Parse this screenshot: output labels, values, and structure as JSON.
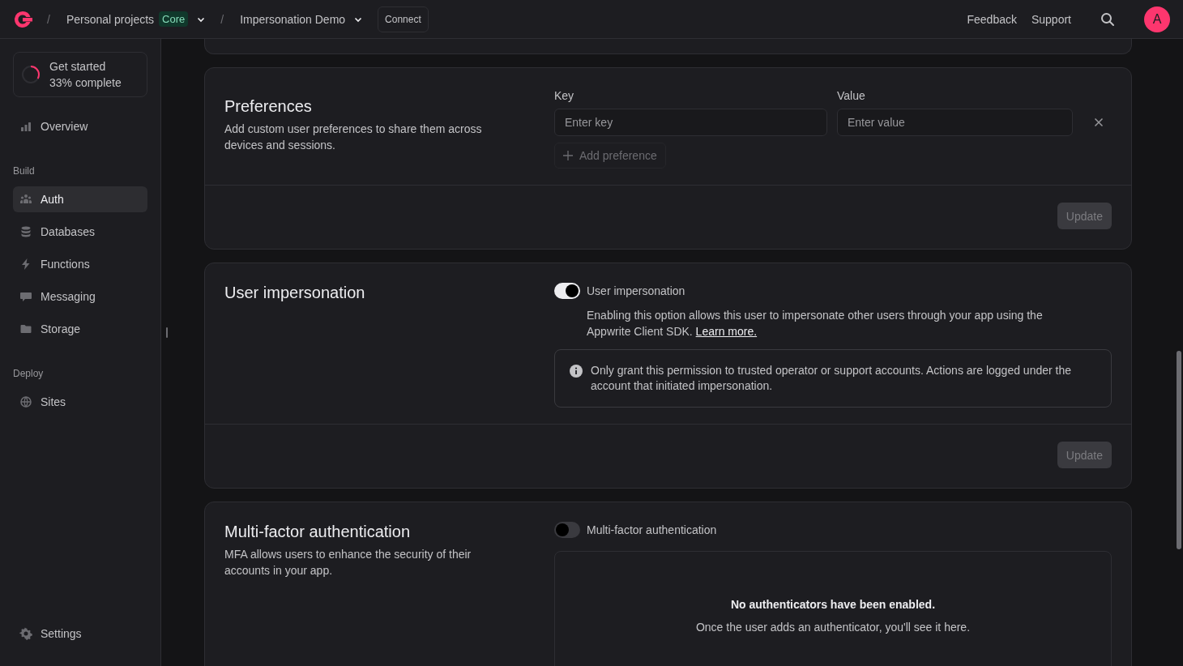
{
  "topbar": {
    "breadcrumbs": [
      {
        "separator": "/",
        "label": "Personal projects",
        "badge": "Core"
      },
      {
        "separator": "/",
        "label": "Impersonation Demo"
      }
    ],
    "connect": "Connect",
    "links": [
      "Feedback",
      "Support"
    ],
    "avatar": "A"
  },
  "sidebar": {
    "progress": {
      "title": "Get started",
      "subtitle": "33% complete",
      "level": 0.33
    },
    "groups": [
      {
        "items": [
          {
            "label": "Overview",
            "selected": false
          }
        ]
      },
      {
        "heading": "Build",
        "items": [
          {
            "label": "Auth",
            "selected": true
          },
          {
            "label": "Databases",
            "selected": false
          },
          {
            "label": "Functions",
            "selected": false
          },
          {
            "label": "Messaging",
            "selected": false
          },
          {
            "label": "Storage",
            "selected": false
          }
        ]
      },
      {
        "heading": "Deploy",
        "items": [
          {
            "label": "Sites",
            "selected": false
          }
        ]
      }
    ],
    "footer": {
      "label": "Settings",
      "selected": false
    }
  },
  "preferences": {
    "title": "Preferences",
    "description": "Add custom user preferences to share them across devices and sessions.",
    "key_label": "Key",
    "value_label": "Value",
    "key_placeholder": "Enter key",
    "value_placeholder": "Enter value",
    "add_button": "Add preference",
    "update_button": {
      "label": "Update",
      "disabled": true
    }
  },
  "impersonation": {
    "title": "User impersonation",
    "toggle": {
      "label": "User impersonation",
      "on": true
    },
    "description": "Enabling this option allows this user to impersonate other users through your app using the Appwrite Client SDK.",
    "link": "Learn more.",
    "notice": "Only grant this permission to trusted operator or support accounts. Actions are logged under the account that initiated impersonation.",
    "update_button": {
      "label": "Update",
      "disabled": true
    }
  },
  "mfa": {
    "title": "Multi-factor authentication",
    "description": "MFA allows users to enhance the security of their accounts in your app.",
    "toggle": {
      "label": "Multi-factor authentication",
      "on": false
    },
    "empty_title": "No authenticators have been enabled.",
    "empty_text": "Once the user adds an authenticator, you'll see it here."
  }
}
